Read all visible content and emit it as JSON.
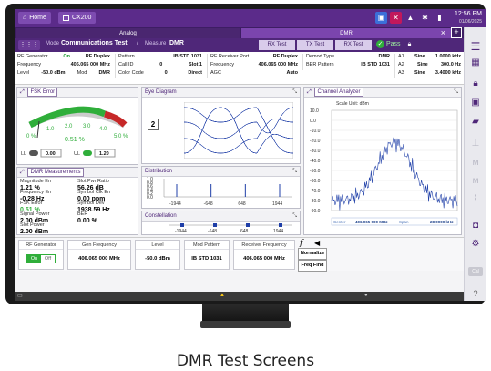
{
  "topbar": {
    "home_label": "Home",
    "device_label": "CX200",
    "time": "12:56 PM",
    "date": "01/06/2025"
  },
  "tabs": {
    "analog": "Analog",
    "dmr": "DMR"
  },
  "modebar": {
    "mode_label": "Mode",
    "mode_value": "Communications Test",
    "measure_label": "Measure",
    "measure_value": "DMR",
    "segs": [
      "RX Test",
      "TX Test",
      "RX Test"
    ],
    "pass": "Pass"
  },
  "params": {
    "col1": [
      {
        "k": "RF Generator",
        "v1": "On",
        "v2": "RF Duplex"
      },
      {
        "k": "Frequency",
        "v1": "406.065 000 MHz",
        "v2": ""
      },
      {
        "k": "Level",
        "v1": "-50.0 dBm",
        "v2": "Mod",
        "v3": "DMR"
      }
    ],
    "col2": [
      {
        "k": "Pattern",
        "v": "IB STD 1031"
      },
      {
        "k": "Call ID",
        "v1": "0",
        "v": "Slot 1"
      },
      {
        "k": "Color Code",
        "v1": "0",
        "v": "Direct"
      }
    ],
    "col3": [
      {
        "k": "RF Receiver Port",
        "v": "RF Duplex"
      },
      {
        "k": "Frequency",
        "v": "406.065 000 MHz"
      },
      {
        "k": "AGC",
        "v": "Auto"
      }
    ],
    "col4": [
      {
        "k": "Demod Type",
        "v": "DMR"
      },
      {
        "k": "BER Pattern",
        "v": "IB STD 1031"
      },
      {
        "k": "",
        "v": ""
      }
    ],
    "col5": [
      {
        "k": "A1",
        "t": "Sine",
        "v": "1.0000 kHz"
      },
      {
        "k": "A2",
        "t": "Sine",
        "v": "300.0 Hz"
      },
      {
        "k": "A3",
        "t": "Sine",
        "v": "3.4000 kHz"
      }
    ]
  },
  "fsk_error": {
    "title": "FSK Error",
    "scale": [
      "0 %",
      "1.0",
      "2.0",
      "3.0",
      "4.0",
      "5.0 %"
    ],
    "value": "0.51 %",
    "ll_label": "LL",
    "ll_value": "0.00",
    "ul_label": "UL",
    "ul_value": "1.20"
  },
  "eye": {
    "title": "Eye Diagram",
    "symbols": "2"
  },
  "distribution": {
    "title": "Distribution",
    "y_ticks": [
      "1.0",
      "0.8",
      "0.6",
      "0.4",
      "0.2",
      "0.0"
    ],
    "x_ticks": [
      "-1944",
      "-648",
      "648",
      "1944"
    ]
  },
  "constellation": {
    "title": "Constellation",
    "x_ticks": [
      "-1944",
      "-648",
      "648",
      "1944"
    ]
  },
  "channel_analyzer": {
    "title": "Channel Analyzer",
    "scale_unit": "Scale Unit: dBm",
    "y_ticks": [
      "10.0",
      "0.0",
      "-10.0",
      "-20.0",
      "-30.0",
      "-40.0",
      "-50.0",
      "-60.0",
      "-70.0",
      "-80.0",
      "-90.0"
    ],
    "center_label": "Center",
    "center_value": "406.065 000 MHz",
    "span_label": "Span",
    "span_value": "28.0000 kHz"
  },
  "dmr_meas": {
    "title": "DMR Measurements",
    "rows": [
      {
        "k1": "Magnitude Err",
        "v1": "1.21 %",
        "k2": "Slot Pwr Ratio",
        "v2": "56.26 dB"
      },
      {
        "k1": "Frequency Err",
        "v1": "-0.28 Hz",
        "k2": "Symbol Clk Err",
        "v2": "0.00 ppm"
      },
      {
        "k1": "FSK Error",
        "v1": "0.51 %",
        "k2": "Symbol Dev",
        "v2": "1938.59 Hz"
      },
      {
        "k1": "Signal Power",
        "v1": "2.00 dBm",
        "k2": "BER",
        "v2": "0.00 %"
      },
      {
        "k1": "Slot Power",
        "v1": "2.00 dBm",
        "k2": "",
        "v2": ""
      }
    ]
  },
  "bottom": {
    "rf_gen_label": "RF Generator",
    "on": "On",
    "off": "Off",
    "gen_freq_label": "Gen Frequency",
    "gen_freq_value": "406.065 000 MHz",
    "level_label": "Level",
    "level_value": "-50.0 dBm",
    "mod_pattern_label": "Mod Pattern",
    "mod_pattern_value": "IB STD 1031",
    "rcv_freq_label": "Receiver Frequency",
    "rcv_freq_value": "406.065 000 MHz",
    "normalize": "Normalize",
    "freq_find": "Freq Find",
    "fx": "f"
  },
  "caption": "DMR Test Screens",
  "colors": {
    "brand": "#5b2b8a",
    "pass": "#2fae3a",
    "trace": "#1f3fa8"
  }
}
